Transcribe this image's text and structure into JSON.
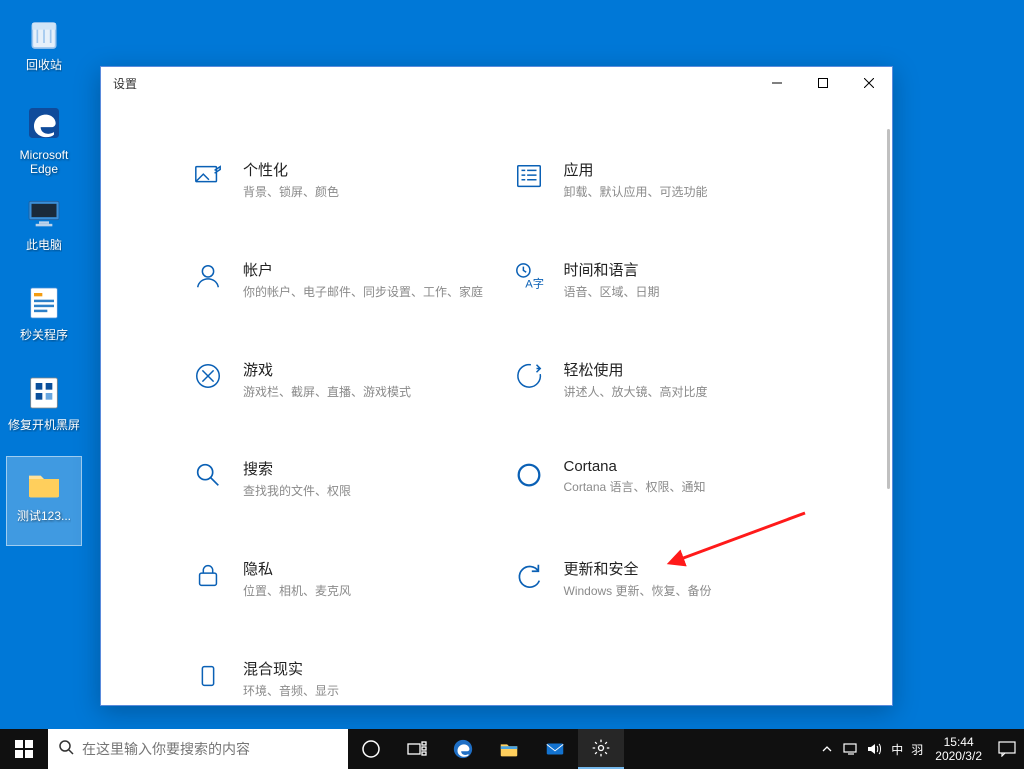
{
  "desktop": {
    "icons": [
      {
        "name": "recycle-bin",
        "label": "回收站"
      },
      {
        "name": "edge",
        "label": "Microsoft Edge"
      },
      {
        "name": "this-pc",
        "label": "此电脑"
      },
      {
        "name": "shutdown-app",
        "label": "秒关程序"
      },
      {
        "name": "fix-black-screen",
        "label": "修复开机黑屏"
      },
      {
        "name": "test-folder",
        "label": "测试123..."
      }
    ]
  },
  "settings": {
    "window_title": "设置",
    "categories": [
      {
        "id": "personalization",
        "title": "个性化",
        "sub": "背景、锁屏、颜色"
      },
      {
        "id": "apps",
        "title": "应用",
        "sub": "卸载、默认应用、可选功能"
      },
      {
        "id": "accounts",
        "title": "帐户",
        "sub": "你的帐户、电子邮件、同步设置、工作、家庭"
      },
      {
        "id": "time-lang",
        "title": "时间和语言",
        "sub": "语音、区域、日期"
      },
      {
        "id": "gaming",
        "title": "游戏",
        "sub": "游戏栏、截屏、直播、游戏模式"
      },
      {
        "id": "ease-of-access",
        "title": "轻松使用",
        "sub": "讲述人、放大镜、高对比度"
      },
      {
        "id": "search",
        "title": "搜索",
        "sub": "查找我的文件、权限"
      },
      {
        "id": "cortana",
        "title": "Cortana",
        "sub": "Cortana 语言、权限、通知"
      },
      {
        "id": "privacy",
        "title": "隐私",
        "sub": "位置、相机、麦克风"
      },
      {
        "id": "update",
        "title": "更新和安全",
        "sub": "Windows 更新、恢复、备份"
      },
      {
        "id": "mixed-reality",
        "title": "混合现实",
        "sub": "环境、音频、显示"
      }
    ]
  },
  "taskbar": {
    "search_placeholder": "在这里输入你要搜索的内容",
    "ime": "中",
    "ime2": "羽",
    "time": "15:44",
    "date": "2020/3/2"
  }
}
